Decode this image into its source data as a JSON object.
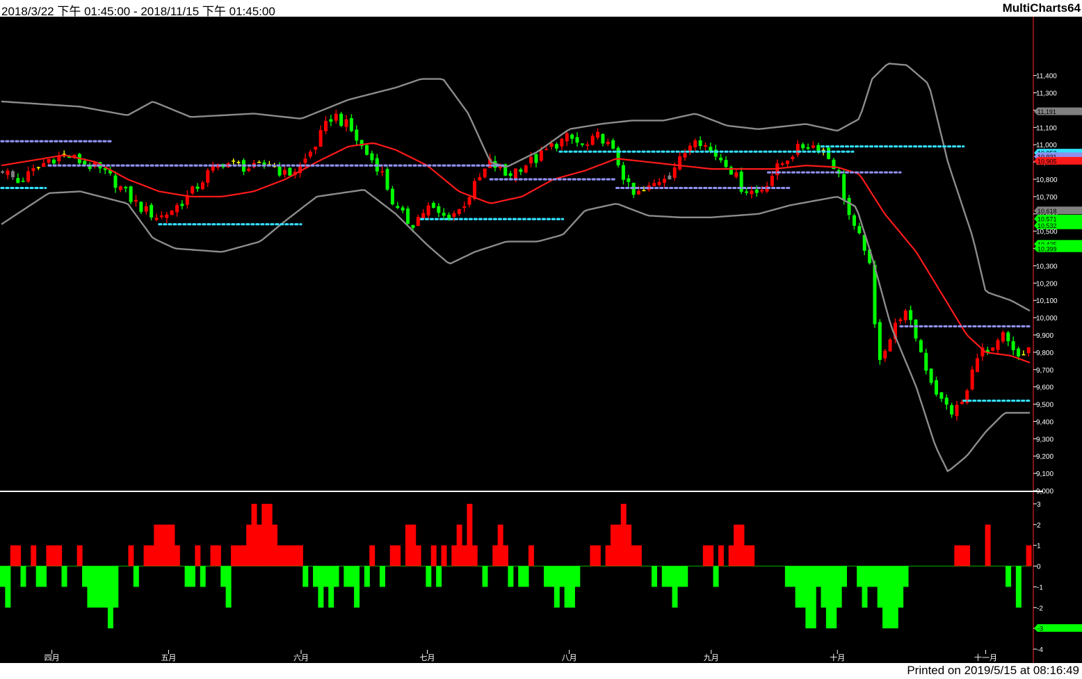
{
  "header": {
    "range_text": "2018/3/22 下午 01:45:00 - 2018/11/15 下午 01:45:00",
    "app_name": "MultiCharts64"
  },
  "footer": {
    "printed_text": "Printed on 2019/5/15 at 08:16:49"
  },
  "colors": {
    "up": "#ff0000",
    "down": "#00ff00",
    "doji": "#ffff00",
    "neutral": "#808080",
    "band": "#8c8c8c",
    "ma": "#ff1a1a",
    "cyan_level": "#33e0ff",
    "purple_level": "#9090ee"
  },
  "chart_data": [
    {
      "type": "candlestick",
      "name": "price",
      "ylim": [
        9000,
        11700
      ],
      "y_ticks": [
        9000,
        9100,
        9200,
        9300,
        9400,
        9500,
        9600,
        9700,
        9800,
        9900,
        10000,
        10100,
        10200,
        10300,
        10400,
        10500,
        10600,
        10700,
        10800,
        10900,
        11000,
        11100,
        11200,
        11300,
        11400
      ],
      "y_tick_labels": [
        "9,000",
        "9,100",
        "9,200",
        "9,300",
        "9,400",
        "9,500",
        "9,600",
        "9,700",
        "9,800",
        "9,900",
        "10,000",
        "10,100",
        "10,200",
        "10,300",
        "10,400",
        "10,500",
        "10,600",
        "10,700",
        "10,800",
        "10,900",
        "11,000",
        "11,100",
        "11,200",
        "11,300",
        "11,400"
      ],
      "bar_count": 166,
      "month_labels": [
        {
          "index": 16,
          "label": "四月"
        },
        {
          "index": 53,
          "label": "五月"
        },
        {
          "index": 95,
          "label": "六月"
        },
        {
          "index": 135,
          "label": "七月"
        },
        {
          "index": 180,
          "label": "八月"
        },
        {
          "index": 225,
          "label": "九月"
        },
        {
          "index": 265,
          "label": "十月"
        },
        {
          "index": 312,
          "label": "十一月"
        }
      ],
      "key_points": [
        [
          0,
          10860
        ],
        [
          5,
          10780
        ],
        [
          10,
          10850
        ],
        [
          15,
          10920
        ],
        [
          20,
          10940
        ],
        [
          25,
          10900
        ],
        [
          30,
          10860
        ],
        [
          35,
          10800
        ],
        [
          40,
          10700
        ],
        [
          45,
          10620
        ],
        [
          50,
          10580
        ],
        [
          55,
          10640
        ],
        [
          60,
          10720
        ],
        [
          65,
          10830
        ],
        [
          70,
          10900
        ],
        [
          75,
          10880
        ],
        [
          80,
          10860
        ],
        [
          85,
          10900
        ],
        [
          90,
          10820
        ],
        [
          95,
          10880
        ],
        [
          100,
          11020
        ],
        [
          105,
          11180
        ],
        [
          110,
          11100
        ],
        [
          115,
          10960
        ],
        [
          120,
          10860
        ],
        [
          125,
          10620
        ],
        [
          130,
          10540
        ],
        [
          135,
          10640
        ],
        [
          140,
          10580
        ],
        [
          145,
          10620
        ],
        [
          150,
          10760
        ],
        [
          155,
          10900
        ],
        [
          160,
          10820
        ],
        [
          165,
          10880
        ],
        [
          170,
          10920
        ],
        [
          175,
          11000
        ],
        [
          180,
          11040
        ],
        [
          185,
          10980
        ],
        [
          190,
          11060
        ],
        [
          195,
          10920
        ],
        [
          200,
          10700
        ],
        [
          205,
          10740
        ],
        [
          210,
          10820
        ],
        [
          215,
          10900
        ],
        [
          220,
          11060
        ],
        [
          225,
          10960
        ],
        [
          230,
          10900
        ],
        [
          235,
          10750
        ],
        [
          240,
          10720
        ],
        [
          245,
          10840
        ],
        [
          250,
          10940
        ],
        [
          255,
          11000
        ],
        [
          260,
          10990
        ],
        [
          265,
          10860
        ],
        [
          270,
          10520
        ],
        [
          275,
          10380
        ],
        [
          278,
          9760
        ],
        [
          282,
          9880
        ],
        [
          286,
          10050
        ],
        [
          290,
          9900
        ],
        [
          294,
          9680
        ],
        [
          298,
          9520
        ],
        [
          302,
          9450
        ],
        [
          306,
          9540
        ],
        [
          310,
          9820
        ],
        [
          314,
          9780
        ],
        [
          318,
          9900
        ],
        [
          322,
          9760
        ],
        [
          326,
          9820
        ]
      ],
      "series": [
        {
          "name": "",
          "style": "band-upper",
          "points": [
            [
              0,
              11250
            ],
            [
              25,
              11220
            ],
            [
              40,
              11170
            ],
            [
              48,
              11250
            ],
            [
              60,
              11160
            ],
            [
              80,
              11180
            ],
            [
              95,
              11150
            ],
            [
              110,
              11260
            ],
            [
              125,
              11330
            ],
            [
              133,
              11380
            ],
            [
              140,
              11380
            ],
            [
              148,
              11180
            ],
            [
              155,
              10900
            ],
            [
              160,
              10870
            ],
            [
              170,
              10960
            ],
            [
              180,
              11090
            ],
            [
              190,
              11120
            ],
            [
              200,
              11140
            ],
            [
              210,
              11140
            ],
            [
              220,
              11180
            ],
            [
              230,
              11110
            ],
            [
              240,
              11090
            ],
            [
              255,
              11120
            ],
            [
              265,
              11080
            ],
            [
              272,
              11150
            ],
            [
              276,
              11380
            ],
            [
              281,
              11470
            ],
            [
              287,
              11460
            ],
            [
              294,
              11350
            ],
            [
              300,
              10900
            ],
            [
              308,
              10460
            ],
            [
              312,
              10150
            ],
            [
              320,
              10100
            ],
            [
              326,
              10040
            ]
          ]
        },
        {
          "name": "",
          "style": "band-lower",
          "points": [
            [
              0,
              10540
            ],
            [
              15,
              10720
            ],
            [
              25,
              10730
            ],
            [
              40,
              10660
            ],
            [
              48,
              10460
            ],
            [
              55,
              10400
            ],
            [
              70,
              10380
            ],
            [
              82,
              10440
            ],
            [
              90,
              10560
            ],
            [
              100,
              10700
            ],
            [
              115,
              10740
            ],
            [
              125,
              10600
            ],
            [
              135,
              10420
            ],
            [
              142,
              10310
            ],
            [
              150,
              10380
            ],
            [
              160,
              10440
            ],
            [
              170,
              10440
            ],
            [
              178,
              10480
            ],
            [
              185,
              10620
            ],
            [
              195,
              10660
            ],
            [
              205,
              10590
            ],
            [
              215,
              10580
            ],
            [
              225,
              10580
            ],
            [
              240,
              10600
            ],
            [
              250,
              10650
            ],
            [
              265,
              10700
            ],
            [
              271,
              10640
            ],
            [
              276,
              10350
            ],
            [
              282,
              9950
            ],
            [
              290,
              9600
            ],
            [
              296,
              9260
            ],
            [
              300,
              9110
            ],
            [
              306,
              9200
            ],
            [
              312,
              9340
            ],
            [
              318,
              9450
            ],
            [
              326,
              9450
            ]
          ]
        },
        {
          "name": "",
          "style": "moving-average",
          "points": [
            [
              0,
              10880
            ],
            [
              10,
              10910
            ],
            [
              20,
              10940
            ],
            [
              30,
              10900
            ],
            [
              40,
              10800
            ],
            [
              50,
              10730
            ],
            [
              60,
              10700
            ],
            [
              70,
              10700
            ],
            [
              80,
              10730
            ],
            [
              90,
              10800
            ],
            [
              100,
              10900
            ],
            [
              110,
              10990
            ],
            [
              118,
              11010
            ],
            [
              125,
              10970
            ],
            [
              135,
              10880
            ],
            [
              145,
              10730
            ],
            [
              155,
              10660
            ],
            [
              165,
              10700
            ],
            [
              175,
              10800
            ],
            [
              185,
              10850
            ],
            [
              195,
              10920
            ],
            [
              205,
              10900
            ],
            [
              215,
              10880
            ],
            [
              225,
              10860
            ],
            [
              235,
              10860
            ],
            [
              245,
              10860
            ],
            [
              255,
              10880
            ],
            [
              265,
              10870
            ],
            [
              272,
              10830
            ],
            [
              280,
              10600
            ],
            [
              290,
              10380
            ],
            [
              300,
              10080
            ],
            [
              306,
              9900
            ],
            [
              312,
              9800
            ],
            [
              320,
              9780
            ],
            [
              326,
              9740
            ]
          ]
        },
        {
          "name": "",
          "style": "level-cyan",
          "segments": [
            [
              0,
              14,
              10750
            ],
            [
              50,
              95,
              10540
            ],
            [
              133,
              178,
              10570
            ],
            [
              177,
              270,
              10960
            ],
            [
              260,
              305,
              10990
            ],
            [
              305,
              326,
              9520
            ]
          ]
        },
        {
          "name": "",
          "style": "level-purple",
          "segments": [
            [
              0,
              35,
              11020
            ],
            [
              15,
              160,
              10880
            ],
            [
              155,
              195,
              10800
            ],
            [
              195,
              250,
              10750
            ],
            [
              243,
              285,
              10840
            ],
            [
              285,
              326,
              9950
            ]
          ]
        }
      ],
      "axis_tags": [
        {
          "value": 11191,
          "label": "11,191",
          "color": "#808080"
        },
        {
          "value": 10952,
          "label": "10,952",
          "color": "#33e0ff"
        },
        {
          "value": 10931,
          "label": "10,931",
          "color": "#9090ee"
        },
        {
          "value": 10905,
          "label": "10,905",
          "color": "#ff1a1a"
        },
        {
          "value": 10618,
          "label": "10,618",
          "color": "#808080"
        },
        {
          "value": 10571,
          "label": "10,571",
          "color": "#00ff00"
        },
        {
          "value": 10532,
          "label": "10,532",
          "color": "#00ff00"
        },
        {
          "value": 10425,
          "label": "10,425",
          "color": "#00ff00"
        },
        {
          "value": 10399,
          "label": "10,399",
          "color": "#00ff00"
        }
      ]
    },
    {
      "type": "histogram",
      "name": "oscillator",
      "ylim": [
        -4,
        3.5
      ],
      "y_ticks": [
        -4,
        -3,
        -2,
        -1,
        0,
        1,
        2,
        3
      ],
      "y_tick_labels": [
        "-4",
        "-3",
        "-2",
        "-1",
        "0",
        "1",
        "2",
        "3"
      ],
      "values": [
        -1,
        -2,
        1,
        1,
        -1,
        0,
        1,
        -1,
        -1,
        1,
        1,
        1,
        -1,
        0,
        0,
        1,
        -1,
        -2,
        -2,
        -2,
        -2,
        -3,
        -2,
        0,
        0,
        1,
        -1,
        0,
        1,
        1,
        2,
        2,
        2,
        2,
        1,
        0,
        -1,
        -1,
        1,
        -1,
        0,
        1,
        1,
        -1,
        -2,
        1,
        1,
        1,
        2,
        3,
        2,
        3,
        3,
        2,
        1,
        1,
        1,
        1,
        1,
        -1,
        0,
        -1,
        -2,
        -1,
        -2,
        -1,
        0,
        -1,
        -1,
        -2,
        0,
        -1,
        1,
        0,
        -1,
        0,
        1,
        1,
        0,
        2,
        2,
        1,
        0,
        -1,
        1,
        -1,
        1,
        0,
        1,
        2,
        1,
        3,
        1,
        0,
        -1,
        0,
        1,
        2,
        1,
        -1,
        0,
        -1,
        -1,
        1,
        0,
        0,
        -1,
        -1,
        -2,
        -1,
        -2,
        -2,
        -1,
        0,
        0,
        1,
        1,
        0,
        1,
        2,
        2,
        3,
        2,
        1,
        1,
        0,
        0,
        -1,
        0,
        -1,
        -1,
        -2,
        -1,
        -1,
        0,
        0,
        0,
        1,
        1,
        -1,
        1,
        0,
        1,
        2,
        2,
        1,
        1,
        0,
        0,
        0,
        0,
        0,
        0,
        -1,
        -1,
        -2,
        -2,
        -3,
        -3,
        -1,
        -2,
        -3,
        -3,
        -2,
        -1,
        0,
        0,
        -1,
        -2,
        -1,
        -1,
        -2,
        -3,
        -3,
        -3,
        -2,
        -1,
        0,
        0,
        0,
        0,
        0,
        0,
        0,
        0,
        0,
        1,
        1,
        1,
        0,
        0,
        0,
        2,
        0,
        0,
        0,
        -1,
        0,
        -2,
        0,
        1
      ]
    }
  ]
}
